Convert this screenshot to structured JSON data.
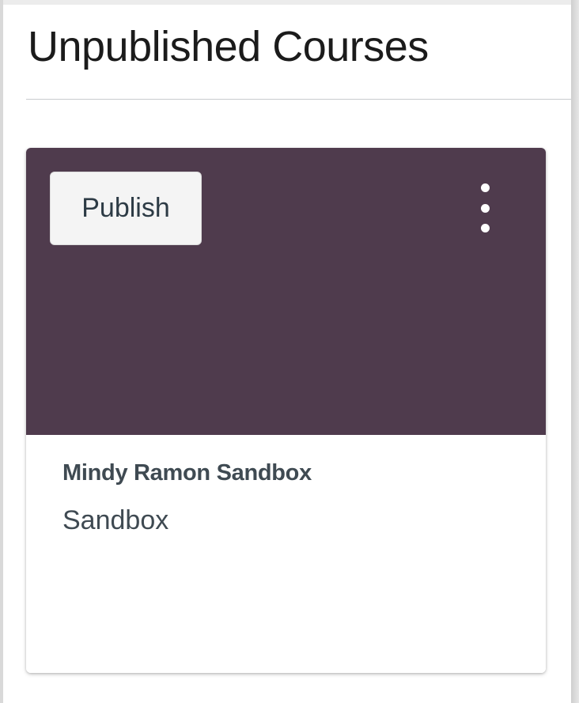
{
  "section": {
    "title": "Unpublished Courses"
  },
  "course_card": {
    "header_color": "#4f3b4d",
    "publish_label": "Publish",
    "menu_icon": "kebab-menu-icon",
    "course_name": "Mindy Ramon Sandbox",
    "course_term": "Sandbox"
  }
}
